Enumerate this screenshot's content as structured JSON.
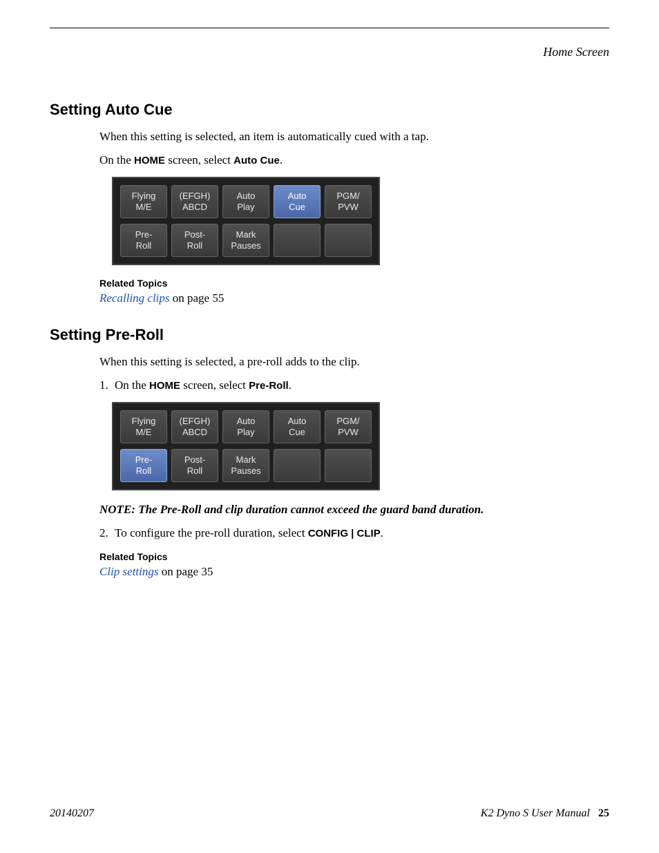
{
  "header": {
    "section": "Home Screen"
  },
  "sections": {
    "autoCue": {
      "heading": "Setting Auto Cue",
      "intro": "When this setting is selected, an item is automatically cued with a tap.",
      "step_prefix": "On the ",
      "step_bold1": "HOME",
      "step_mid": " screen, select ",
      "step_bold2": "Auto Cue",
      "step_suffix": ".",
      "related_label": "Related Topics",
      "related_link": "Recalling clips",
      "related_rest": " on page 55"
    },
    "preRoll": {
      "heading": "Setting Pre-Roll",
      "intro": "When this setting is selected, a pre-roll adds to the clip.",
      "step1_num": "1.",
      "step1_prefix": " On the ",
      "step1_bold1": "HOME",
      "step1_mid": " screen, select ",
      "step1_bold2": "Pre-Roll",
      "step1_suffix": ".",
      "note_label": "NOTE:  ",
      "note_body": "The Pre-Roll and clip duration cannot exceed the guard band duration.",
      "step2_num": "2.",
      "step2_prefix": " To configure the pre-roll duration, select ",
      "step2_bold": "CONFIG | CLIP",
      "step2_suffix": ".",
      "related_label": "Related Topics",
      "related_link": "Clip settings",
      "related_rest": " on page 35"
    }
  },
  "panel1": {
    "buttons": [
      {
        "l1": "Flying",
        "l2": "M/E",
        "sel": false
      },
      {
        "l1": "(EFGH)",
        "l2": "ABCD",
        "sel": false
      },
      {
        "l1": "Auto",
        "l2": "Play",
        "sel": false
      },
      {
        "l1": "Auto",
        "l2": "Cue",
        "sel": true
      },
      {
        "l1": "PGM/",
        "l2": "PVW",
        "sel": false
      },
      {
        "l1": "Pre-",
        "l2": "Roll",
        "sel": false
      },
      {
        "l1": "Post-",
        "l2": "Roll",
        "sel": false
      },
      {
        "l1": "Mark",
        "l2": "Pauses",
        "sel": false
      },
      {
        "l1": "",
        "l2": "",
        "sel": false
      },
      {
        "l1": "",
        "l2": "",
        "sel": false
      }
    ]
  },
  "panel2": {
    "buttons": [
      {
        "l1": "Flying",
        "l2": "M/E",
        "sel": false
      },
      {
        "l1": "(EFGH)",
        "l2": "ABCD",
        "sel": false
      },
      {
        "l1": "Auto",
        "l2": "Play",
        "sel": false
      },
      {
        "l1": "Auto",
        "l2": "Cue",
        "sel": false
      },
      {
        "l1": "PGM/",
        "l2": "PVW",
        "sel": false
      },
      {
        "l1": "Pre-",
        "l2": "Roll",
        "sel": true
      },
      {
        "l1": "Post-",
        "l2": "Roll",
        "sel": false
      },
      {
        "l1": "Mark",
        "l2": "Pauses",
        "sel": false
      },
      {
        "l1": "",
        "l2": "",
        "sel": false
      },
      {
        "l1": "",
        "l2": "",
        "sel": false
      }
    ]
  },
  "footer": {
    "date": "20140207",
    "manual": "K2 Dyno S   User Manual",
    "page": "25"
  }
}
